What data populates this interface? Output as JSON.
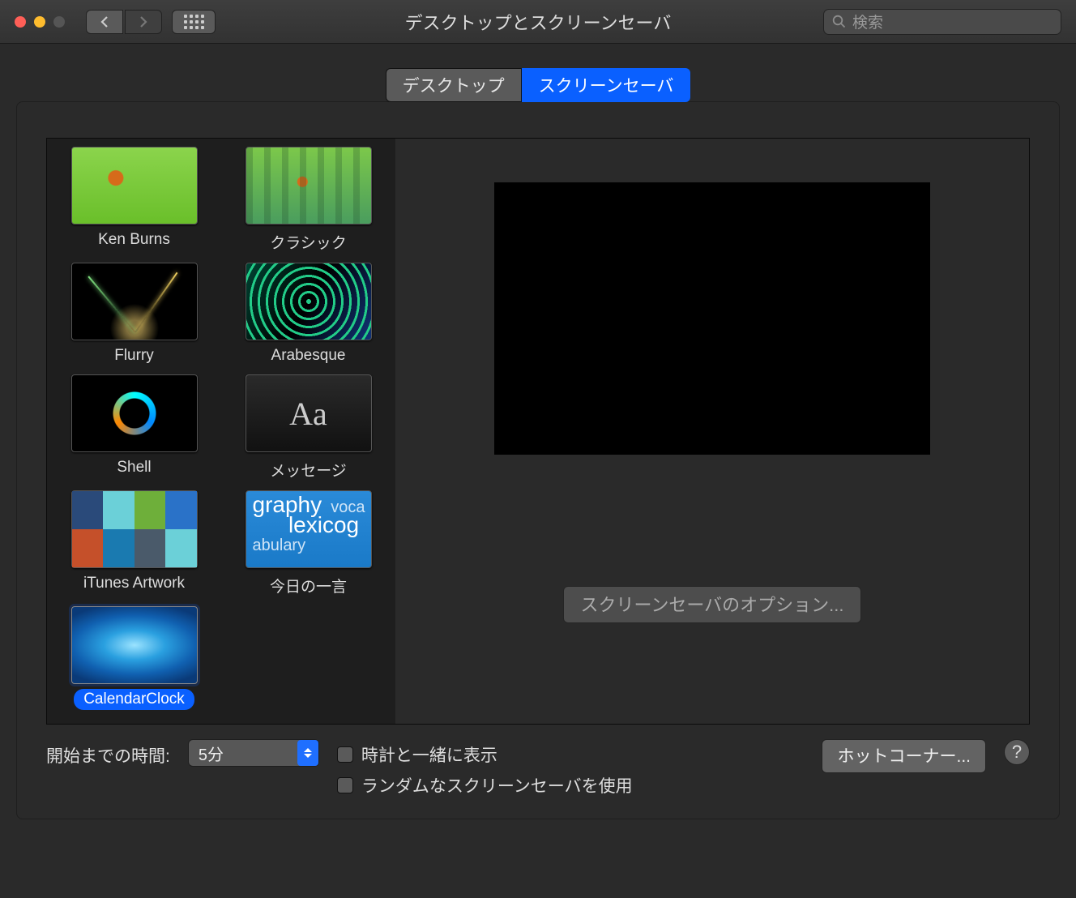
{
  "window": {
    "title": "デスクトップとスクリーンセーバ"
  },
  "search": {
    "placeholder": "検索"
  },
  "tabs": {
    "desktop": "デスクトップ",
    "screensaver": "スクリーンセーバ"
  },
  "savers": [
    {
      "label": "Ken Burns",
      "art": "kenburns"
    },
    {
      "label": "クラシック",
      "art": "classic"
    },
    {
      "label": "Flurry",
      "art": "flurry"
    },
    {
      "label": "Arabesque",
      "art": "arabesque"
    },
    {
      "label": "Shell",
      "art": "shell"
    },
    {
      "label": "メッセージ",
      "art": "message"
    },
    {
      "label": "iTunes Artwork",
      "art": "itunes"
    },
    {
      "label": "今日の一言",
      "art": "word"
    },
    {
      "label": "CalendarClock",
      "art": "cal",
      "selected": true
    }
  ],
  "options_button": "スクリーンセーバのオプション...",
  "start_label": "開始までの時間:",
  "start_value": "5分",
  "check_clock": "時計と一緒に表示",
  "check_random": "ランダムなスクリーンセーバを使用",
  "hot_corners": "ホットコーナー...",
  "help_glyph": "?",
  "message_thumb_text": "Aa",
  "word_thumb_lines": "graphy  voca\n        lexicog\nabulary"
}
